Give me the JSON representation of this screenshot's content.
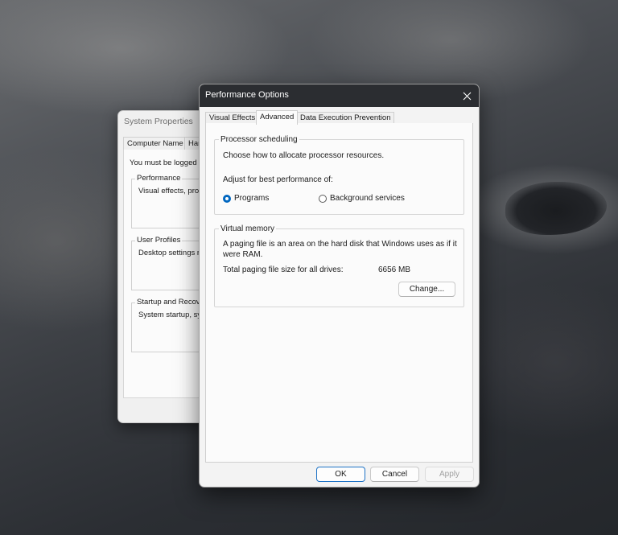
{
  "system_properties": {
    "title": "System Properties",
    "tabs": [
      "Computer Name",
      "Har"
    ],
    "message": "You must be logged",
    "groups": [
      {
        "label": "Performance",
        "desc": "Visual effects, proc"
      },
      {
        "label": "User Profiles",
        "desc": "Desktop settings re"
      },
      {
        "label": "Startup and Recov",
        "desc": "System startup, sys"
      }
    ]
  },
  "dialog": {
    "title": "Performance Options",
    "tabs": [
      "Visual Effects",
      "Advanced",
      "Data Execution Prevention"
    ],
    "active_tab": "Advanced",
    "processor": {
      "group_title": "Processor scheduling",
      "description": "Choose how to allocate processor resources.",
      "adjust_label": "Adjust for best performance of:",
      "options": [
        {
          "label": "Programs",
          "selected": true
        },
        {
          "label": "Background services",
          "selected": false
        }
      ]
    },
    "virtual_memory": {
      "group_title": "Virtual memory",
      "description_line1": "A paging file is an area on the hard disk that Windows uses as if it",
      "description_line2": "were RAM.",
      "total_label": "Total paging file size for all drives:",
      "total_value": "6656 MB",
      "change_button": "Change..."
    },
    "buttons": {
      "ok": "OK",
      "cancel": "Cancel",
      "apply": "Apply"
    }
  },
  "colors": {
    "accent": "#0067c0",
    "titlebar": "#2b2d31"
  },
  "icons": [
    "close-icon"
  ]
}
